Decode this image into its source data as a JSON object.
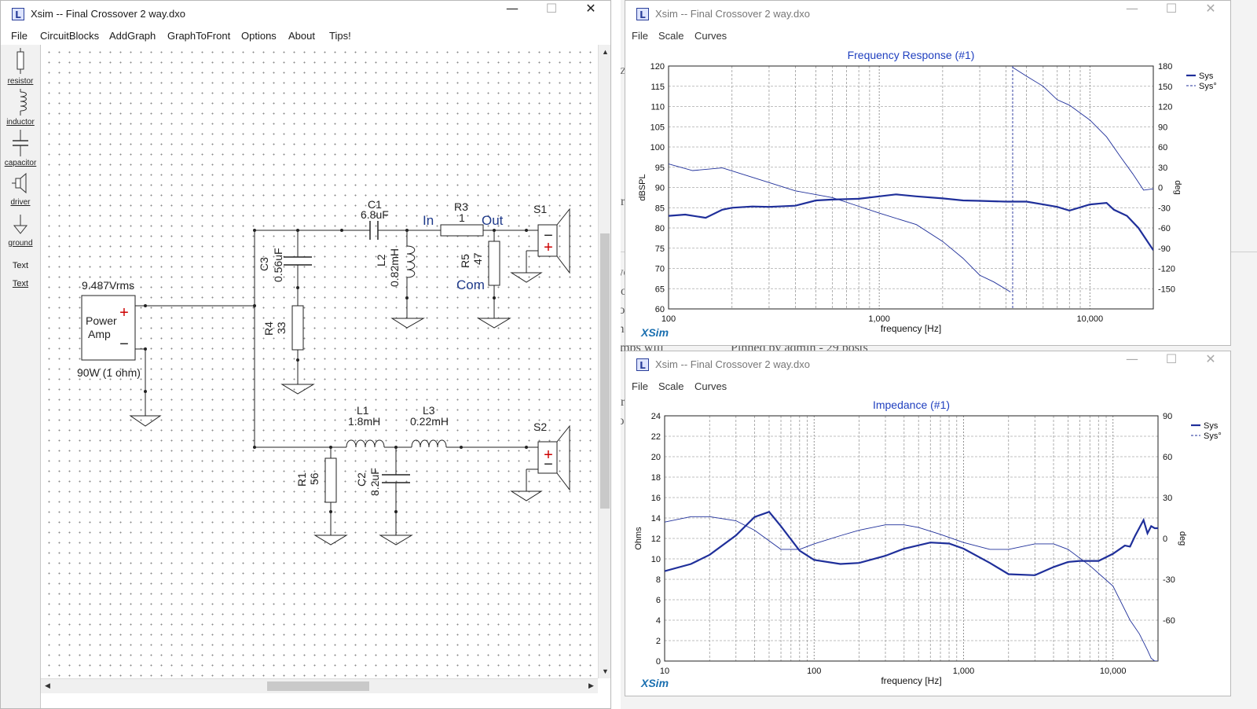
{
  "background_fragments": [
    "EZ",
    "ur",
    "woo",
    "poo",
    "for",
    "the",
    "amps will",
    "Pinned by admin - 29 posts",
    "urr",
    "to"
  ],
  "schematic_window": {
    "title": "Xsim -- Final Crossover 2 way.dxo",
    "controls": [
      "—",
      "☐",
      "✕"
    ],
    "menu": [
      "File",
      "CircuitBlocks",
      "AddGraph",
      "GraphToFront",
      "Options",
      "About",
      "Tips!"
    ],
    "toolbox": [
      {
        "label": "resistor",
        "icon": "resistor-icon"
      },
      {
        "label": "inductor",
        "icon": "inductor-icon"
      },
      {
        "label": "capacitor",
        "icon": "capacitor-icon"
      },
      {
        "label": "driver",
        "icon": "driver-icon"
      },
      {
        "label": "ground",
        "icon": "ground-icon"
      },
      {
        "label": "Text",
        "icon": "text-tool-icon"
      },
      {
        "label": "Text",
        "icon": "text-link-icon"
      }
    ],
    "circuit": {
      "amp": {
        "voltage": "9.487Vrms",
        "name1": "Power",
        "name2": "Amp",
        "power": "90W (1 ohm)",
        "plus": "+",
        "minus": "−"
      },
      "C1": {
        "name": "C1",
        "value": "6.8uF"
      },
      "C3": {
        "name": "C3",
        "value": "0.56uF"
      },
      "R4": {
        "name": "R4",
        "value": "33"
      },
      "L2": {
        "name": "L2",
        "value": "0.82mH"
      },
      "R3": {
        "name": "R3",
        "value": "1"
      },
      "R5": {
        "name": "R5",
        "value": "47"
      },
      "pad_in": "In",
      "pad_out": "Out",
      "pad_com": "Com",
      "S1": "S1",
      "S2": "S2",
      "L1": {
        "name": "L1",
        "value": "1.8mH"
      },
      "L3": {
        "name": "L3",
        "value": "0.22mH"
      },
      "R1": {
        "name": "R1",
        "value": "56"
      },
      "C2": {
        "name": "C2",
        "value": "8.2uF"
      }
    }
  },
  "freq_window": {
    "title": "Xsim -- Final Crossover 2 way.dxo",
    "controls": [
      "—",
      "☐",
      "✕"
    ],
    "menu": [
      "File",
      "Scale",
      "Curves"
    ],
    "brand": "XSim"
  },
  "imp_window": {
    "title": "Xsim -- Final Crossover 2 way.dxo",
    "controls": [
      "—",
      "☐",
      "✕"
    ],
    "menu": [
      "File",
      "Scale",
      "Curves"
    ],
    "brand": "XSim"
  },
  "chart_data": [
    {
      "type": "line",
      "title": "Frequency Response (#1)",
      "xlabel": "frequency [Hz]",
      "ylabel": "dBSPL",
      "y2label": "deg",
      "xscale": "log",
      "xlim": [
        100,
        20000
      ],
      "ylim": [
        60,
        120
      ],
      "y2lim": [
        -180,
        180
      ],
      "xticks": [
        100,
        1000,
        10000
      ],
      "xticklabels": [
        "100",
        "1,000",
        "10,000"
      ],
      "yticks": [
        60,
        65,
        70,
        75,
        80,
        85,
        90,
        95,
        100,
        105,
        110,
        115,
        120
      ],
      "y2ticks": [
        -150,
        -120,
        -90,
        -60,
        -30,
        0,
        30,
        60,
        90,
        120,
        150,
        180
      ],
      "grid": true,
      "legend": "top-right",
      "series": [
        {
          "name": "Sys",
          "axis": "left",
          "style": "solid",
          "x": [
            100,
            120,
            150,
            180,
            200,
            250,
            300,
            400,
            500,
            600,
            800,
            1000,
            1200,
            1500,
            2000,
            2500,
            3000,
            4000,
            5000,
            6000,
            7000,
            8000,
            10000,
            12000,
            13000,
            15000,
            17000,
            20000
          ],
          "y": [
            83,
            83.3,
            82.5,
            84.5,
            85,
            85.3,
            85.2,
            85.5,
            86.8,
            87,
            87.2,
            87.8,
            88.3,
            87.8,
            87.3,
            86.8,
            86.7,
            86.5,
            86.5,
            85.8,
            85.2,
            84.3,
            85.8,
            86.2,
            84.5,
            83,
            80,
            74.5
          ]
        },
        {
          "name": "Sys°",
          "axis": "right",
          "style": "dashed",
          "x": [
            100,
            130,
            180,
            250,
            400,
            600,
            800,
            1000,
            1500,
            2000,
            2500,
            3000,
            3500,
            4200,
            4300,
            5000,
            6000,
            7000,
            8000,
            10000,
            12000,
            14000,
            16000,
            18000,
            20000
          ],
          "y": [
            35,
            25,
            29,
            15,
            -5,
            -15,
            -28,
            -38,
            -55,
            -80,
            -105,
            -130,
            -140,
            -155,
            178,
            165,
            150,
            130,
            122,
            100,
            75,
            45,
            20,
            -4,
            -2
          ]
        }
      ]
    },
    {
      "type": "line",
      "title": "Impedance (#1)",
      "xlabel": "frequency [Hz]",
      "ylabel": "Ohms",
      "y2label": "deg",
      "xscale": "log",
      "xlim": [
        10,
        20000
      ],
      "ylim": [
        0,
        24
      ],
      "y2lim": [
        -90,
        90
      ],
      "xticks": [
        10,
        100,
        1000,
        10000
      ],
      "xticklabels": [
        "10",
        "100",
        "1,000",
        "10,000"
      ],
      "yticks": [
        0,
        2,
        4,
        6,
        8,
        10,
        12,
        14,
        16,
        18,
        20,
        22,
        24
      ],
      "y2ticks": [
        -60,
        -30,
        0,
        30,
        60,
        90
      ],
      "grid": true,
      "legend": "top-right",
      "series": [
        {
          "name": "Sys",
          "axis": "left",
          "style": "solid",
          "x": [
            10,
            15,
            20,
            30,
            40,
            50,
            60,
            80,
            100,
            150,
            200,
            300,
            400,
            600,
            800,
            1000,
            1500,
            2000,
            3000,
            4000,
            5000,
            6000,
            8000,
            10000,
            12000,
            13000,
            14000,
            16000,
            17000,
            18000,
            19000,
            20000
          ],
          "y": [
            8.8,
            9.5,
            10.4,
            12.3,
            14.1,
            14.6,
            13.2,
            10.8,
            9.9,
            9.5,
            9.6,
            10.3,
            11,
            11.6,
            11.5,
            11,
            9.6,
            8.5,
            8.4,
            9.2,
            9.7,
            9.8,
            9.8,
            10.5,
            11.3,
            11.2,
            12.2,
            13.8,
            12.5,
            13.2,
            13,
            13
          ]
        },
        {
          "name": "Sys°",
          "axis": "right",
          "style": "dashed",
          "x": [
            10,
            15,
            20,
            30,
            40,
            60,
            80,
            100,
            150,
            200,
            300,
            400,
            500,
            700,
            1000,
            1500,
            2000,
            3000,
            4000,
            5000,
            7000,
            10000,
            13000,
            15000,
            17000,
            18000,
            19000,
            20000
          ],
          "y": [
            12,
            16,
            16,
            13,
            6,
            -8,
            -8,
            -4,
            2,
            6,
            10,
            10,
            8,
            3,
            -3,
            -8,
            -8,
            -4,
            -4,
            -8,
            -20,
            -35,
            -60,
            -70,
            -82,
            -88,
            -90,
            -90
          ]
        }
      ]
    }
  ]
}
